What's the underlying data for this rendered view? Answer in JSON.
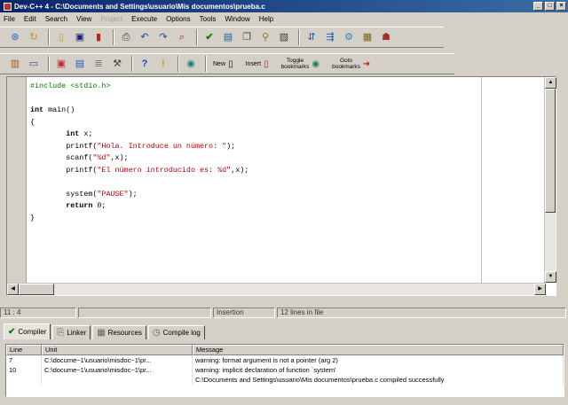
{
  "window": {
    "title": "Dev-C++ 4 - C:\\Documents and Settings\\usuario\\Mis documentos\\prueba.c"
  },
  "menu": [
    "File",
    "Edit",
    "Search",
    "View",
    "Project",
    "Execute",
    "Options",
    "Tools",
    "Window",
    "Help"
  ],
  "toolbar2": {
    "new_label": "New",
    "insert_label": "Insert",
    "toggle_bookmarks": [
      "Toggle",
      "bookmarks"
    ],
    "goto_bookmarks": [
      "Goto",
      "bookmarks"
    ]
  },
  "code": {
    "l1": "#include <stdio.h>",
    "l3_kw": "int",
    "l3_rest": " main()",
    "l4": "{",
    "l5_kw": "int",
    "l5_rest": " x;",
    "l6_a": "printf(",
    "l6_s": "\"Hola. Introduce un número: \"",
    "l6_b": ");",
    "l7_a": "scanf(",
    "l7_s": "\"%d\"",
    "l7_b": ",x);",
    "l8_a": "printf(",
    "l8_s": "\"El número introducido es: %d\"",
    "l8_b": ",x);",
    "l10_a": "system(",
    "l10_s": "\"PAUSE\"",
    "l10_b": ");",
    "l11_kw": "return",
    "l11_rest": " 0;",
    "l12": "}"
  },
  "status": {
    "position": "11 : 4",
    "mode": "Insertion",
    "lines": "12 lines in file"
  },
  "tabs": [
    "Compiler",
    "Linker",
    "Resources",
    "Compile log"
  ],
  "messages": {
    "headers": [
      "Line",
      "Unit",
      "Message"
    ],
    "rows": [
      {
        "line": "7",
        "unit": "C:\\docume~1\\usuario\\misdoc~1\\pr...",
        "message": "warning: format argument is not a pointer (arg 2)"
      },
      {
        "line": "10",
        "unit": "C:\\docume~1\\usuario\\misdoc~1\\pr...",
        "message": "warning: implicit declaration of function `system'"
      },
      {
        "line": "",
        "unit": "",
        "message": "C:\\Documents and Settings\\usuario\\Mis documentos\\prueba.c compiled successfully"
      }
    ]
  }
}
